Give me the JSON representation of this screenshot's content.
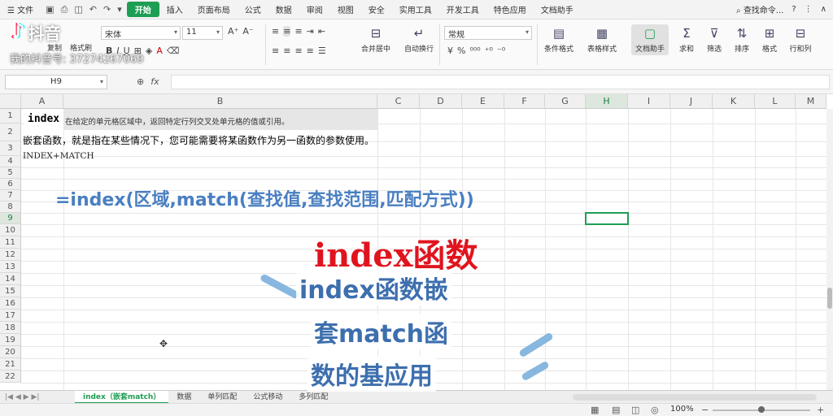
{
  "menu": {
    "file": "文件",
    "tabs": [
      "开始",
      "插入",
      "页面布局",
      "公式",
      "数据",
      "审阅",
      "视图",
      "安全",
      "实用工具",
      "开发工具",
      "特色应用",
      "文档助手"
    ],
    "active_tab": "开始",
    "search": "查找命令..."
  },
  "watermark": {
    "brand": "抖音",
    "id_text": "我的抖音号: 3727426706​9"
  },
  "toolbar": {
    "copy": "复制",
    "format_painter": "格式刷",
    "font_name": "宋体",
    "font_size": "11",
    "merge_center": "合并居中",
    "auto_wrap": "自动换行",
    "number_format": "常规",
    "conditional_format": "条件格式",
    "table_style": "表格样式",
    "doc_helper": "文档助手",
    "sum": "求和",
    "filter": "筛选",
    "sort": "排序",
    "format": "格式",
    "row_col": "行和列"
  },
  "formula_bar": {
    "name_box": "H9",
    "fx": "fx",
    "content": ""
  },
  "grid": {
    "columns": [
      "A",
      "B",
      "C",
      "D",
      "E",
      "F",
      "G",
      "H",
      "I",
      "J",
      "K",
      "L",
      "M"
    ],
    "selected_col": "H",
    "rows": [
      "1",
      "2",
      "3",
      "4",
      "5",
      "6",
      "7",
      "8",
      "9",
      "10",
      "11",
      "12",
      "13",
      "14",
      "15",
      "16",
      "17",
      "18",
      "19",
      "20",
      "21",
      "22"
    ],
    "selected_row": "9",
    "a1": "index",
    "b1": "在给定的单元格区域中，返回特定行列交叉处单元格的值或引用。",
    "a2": "嵌套函数，就是指在某些情况下，您可能需要将某函数作为另一函数的参数使用。",
    "a3": "INDEX+MATCH"
  },
  "overlay": {
    "formula": "=index(区域,match(查找值,查找范围,匹配方式))",
    "title": "index函数",
    "sub1": "index函数嵌",
    "sub2": "套match函",
    "sub3": "数的基应用",
    "colors": {
      "formula": "#4a7fc1",
      "title": "#e0141e",
      "sub": "#3d6fae"
    }
  },
  "sheets": {
    "tabs": [
      "index（嵌套match）",
      "数据",
      "单列匹配",
      "公式移动",
      "多列匹配"
    ],
    "active": "index（嵌套match）"
  },
  "status": {
    "zoom": "100%"
  }
}
